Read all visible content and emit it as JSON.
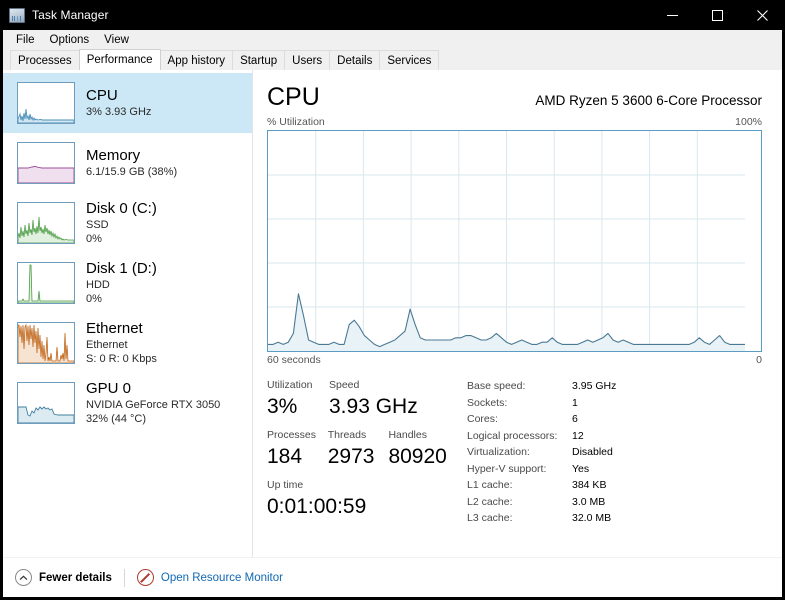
{
  "window": {
    "title": "Task Manager",
    "icon": "task-manager-icon",
    "minimize_label": "—",
    "maximize_label": "□",
    "close_label": "✕"
  },
  "menu": {
    "items": [
      {
        "label": "File"
      },
      {
        "label": "Options"
      },
      {
        "label": "View"
      }
    ]
  },
  "tabs": [
    {
      "label": "Processes",
      "active": false
    },
    {
      "label": "Performance",
      "active": true
    },
    {
      "label": "App history",
      "active": false
    },
    {
      "label": "Startup",
      "active": false
    },
    {
      "label": "Users",
      "active": false
    },
    {
      "label": "Details",
      "active": false
    },
    {
      "label": "Services",
      "active": false
    }
  ],
  "sidebar": {
    "items": [
      {
        "name": "CPU",
        "line2": "3%  3.93 GHz",
        "line3": "",
        "selected": true,
        "color": "#4a90b8"
      },
      {
        "name": "Memory",
        "line2": "6.1/15.9 GB (38%)",
        "line3": "",
        "selected": false,
        "color": "#9c4f96"
      },
      {
        "name": "Disk 0 (C:)",
        "line2": "SSD",
        "line3": "0%",
        "selected": false,
        "color": "#4a9b42"
      },
      {
        "name": "Disk 1 (D:)",
        "line2": "HDD",
        "line3": "0%",
        "selected": false,
        "color": "#4a9b42"
      },
      {
        "name": "Ethernet",
        "line2": "Ethernet",
        "line3": "S: 0 R: 0 Kbps",
        "selected": false,
        "color": "#bf6416"
      },
      {
        "name": "GPU 0",
        "line2": "NVIDIA GeForce RTX 3050",
        "line3": "32%  (44 °C)",
        "selected": false,
        "color": "#3f7f9e"
      }
    ]
  },
  "main": {
    "title": "CPU",
    "subtitle": "AMD Ryzen 5 3600 6-Core Processor",
    "graph_axis_label": "% Utilization",
    "graph_max": "100%",
    "graph_time_left": "60 seconds",
    "graph_time_right": "0",
    "stats_left": [
      {
        "label": "Utilization",
        "value": "3%"
      },
      {
        "label": "Speed",
        "value": "3.93 GHz"
      },
      {
        "label": "Processes",
        "value": "184"
      },
      {
        "label": "Threads",
        "value": "2973"
      },
      {
        "label": "Handles",
        "value": "80920"
      },
      {
        "label": "Up time",
        "value": "0:01:00:59"
      }
    ],
    "stats_right": [
      {
        "label": "Base speed:",
        "value": "3.95 GHz"
      },
      {
        "label": "Sockets:",
        "value": "1"
      },
      {
        "label": "Cores:",
        "value": "6"
      },
      {
        "label": "Logical processors:",
        "value": "12"
      },
      {
        "label": "Virtualization:",
        "value": "Disabled"
      },
      {
        "label": "Hyper-V support:",
        "value": "Yes"
      },
      {
        "label": "L1 cache:",
        "value": "384 KB"
      },
      {
        "label": "L2 cache:",
        "value": "3.0 MB"
      },
      {
        "label": "L3 cache:",
        "value": "32.0 MB"
      }
    ]
  },
  "statusbar": {
    "fewer_details": "Fewer details",
    "fewer_details_icon": "chevron-up-circle-icon",
    "resource_monitor": "Open Resource Monitor",
    "resource_monitor_icon": "resource-monitor-icon"
  },
  "chart_data": {
    "type": "area",
    "title": "CPU % Utilization",
    "xlabel": "",
    "ylabel": "% Utilization",
    "ylim": [
      0,
      100
    ],
    "xlim": [
      60,
      0
    ],
    "x_tick_labels": [
      "60 seconds",
      "0"
    ],
    "y_tick_labels": [
      "100%"
    ],
    "grid": true,
    "line_color": "#4a7a93",
    "fill_color": "#e8f2f7",
    "series": [
      {
        "name": "CPU utilization",
        "values": [
          3,
          3,
          4,
          3,
          4,
          8,
          26,
          16,
          5,
          4,
          3,
          3,
          3,
          4,
          3,
          3,
          12,
          14,
          11,
          7,
          5,
          3,
          2,
          3,
          4,
          5,
          7,
          9,
          19,
          12,
          6,
          5,
          5,
          5,
          5,
          5,
          5,
          6,
          6,
          7,
          7,
          6,
          5,
          5,
          6,
          8,
          6,
          4,
          3,
          4,
          5,
          4,
          3,
          3,
          4,
          4,
          6,
          4,
          3,
          3,
          3,
          3,
          4,
          5,
          4,
          5,
          6,
          8,
          5,
          4,
          5,
          4,
          3,
          3,
          3,
          3,
          3,
          3,
          3,
          3,
          3,
          3,
          3,
          3,
          4,
          6,
          4,
          3,
          5,
          7,
          4,
          3,
          3,
          3,
          3
        ]
      }
    ]
  },
  "thumbnails": {
    "cpu": {
      "line": "#4a90b8",
      "fill": "#d3e7f3"
    },
    "memory": {
      "line": "#9c4f96",
      "fill": "#f0e0ef"
    },
    "disk0": {
      "line": "#4a9b42",
      "fill": "#e1f0df"
    },
    "disk1": {
      "line": "#4a9b42",
      "fill": "#e1f0df"
    },
    "ethernet": {
      "line": "#bf6416",
      "fill": "#f6e3d2"
    },
    "gpu": {
      "line": "#3f7f9e",
      "fill": "#dcebf2"
    }
  }
}
